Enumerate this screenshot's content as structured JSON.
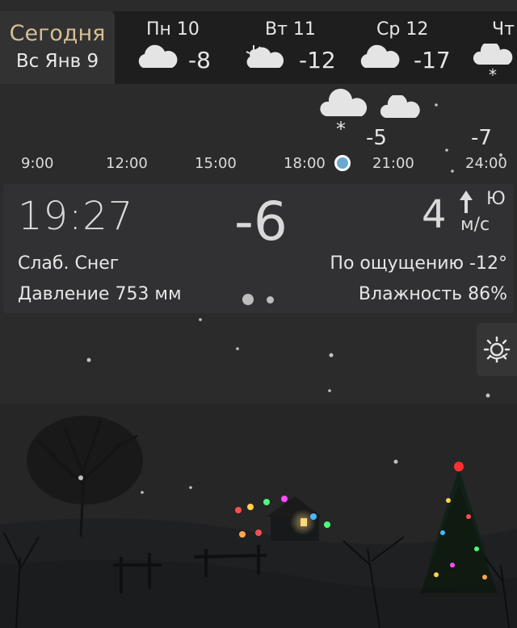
{
  "today": {
    "label": "Сегодня",
    "date": "Вс Янв 9"
  },
  "days": [
    {
      "name": "Пн 10",
      "temp": "-8",
      "icon": "cloud-icon"
    },
    {
      "name": "Вт 11",
      "temp": "-12",
      "icon": "partly-cloudy-icon"
    },
    {
      "name": "Ср 12",
      "temp": "-17",
      "icon": "cloud-icon"
    },
    {
      "name": "Чт",
      "temp": "",
      "icon": "cloud-snow-icon"
    }
  ],
  "timeline": {
    "times": [
      "9:00",
      "12:00",
      "15:00",
      "18:00",
      "21:00",
      "24:00"
    ],
    "temps": [
      "-5",
      "-7"
    ]
  },
  "current": {
    "time": "19:27",
    "temp": "-6",
    "wind_speed": "4",
    "wind_unit": "м/с",
    "wind_dir": "Ю",
    "condition": "Слаб. Снег",
    "pressure": "Давление 753 мм",
    "feels_like": "По ощущению -12°",
    "humidity": "Влажность 86%"
  },
  "colors": {
    "today_accent": "#d7bf93",
    "now_marker": "#6aa8d0"
  }
}
